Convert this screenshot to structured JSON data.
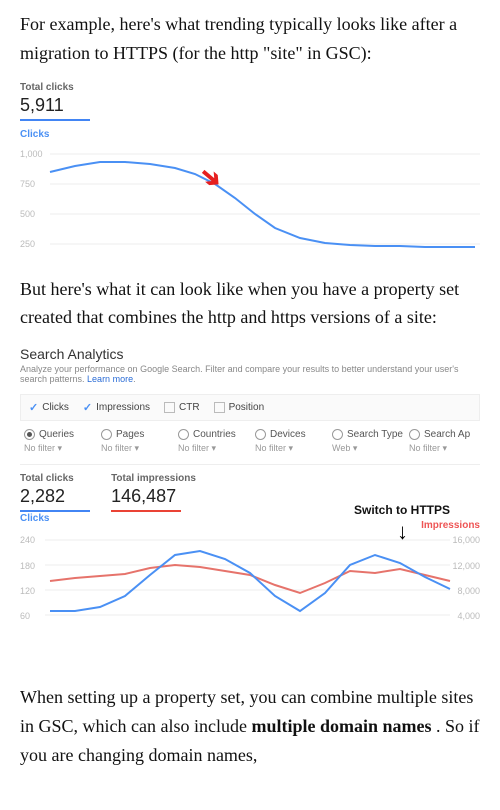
{
  "para1_a": "For example, here's what trending typically looks like after a migration to HTTPS (for the http \"site\" in GSC):",
  "para2": "But here's what it can look like when you have a property set created that combines the http and https versions of a site:",
  "para3_a": "When setting up a property set, you can combine multiple sites in GSC, which can also include ",
  "para3_b": "multiple domain names",
  "para3_c": ". So if you are changing domain names, ",
  "chart1": {
    "metric_label": "Total clicks",
    "metric_value": "5,911",
    "axis_label": "Clicks",
    "yticks": [
      "1,000",
      "750",
      "500",
      "250"
    ]
  },
  "sa_title": "Search Analytics",
  "sa_desc_a": "Analyze your performance on Google Search. Filter and compare your results to better understand your user's search patterns. ",
  "sa_desc_link": "Learn more",
  "sa_desc_b": ".",
  "toolbar": {
    "clicks": "Clicks",
    "impressions": "Impressions",
    "ctr": "CTR",
    "position": "Position"
  },
  "filters": [
    {
      "name": "Queries",
      "sub": "No filter ▾",
      "selected": true
    },
    {
      "name": "Pages",
      "sub": "No filter ▾",
      "selected": false
    },
    {
      "name": "Countries",
      "sub": "No filter ▾",
      "selected": false
    },
    {
      "name": "Devices",
      "sub": "No filter ▾",
      "selected": false
    },
    {
      "name": "Search Type",
      "sub": "Web ▾",
      "selected": false
    },
    {
      "name": "Search Ap",
      "sub": "No filter ▾",
      "selected": false
    }
  ],
  "chart2": {
    "m1_label": "Total clicks",
    "m1_value": "2,282",
    "m2_label": "Total impressions",
    "m2_value": "146,487",
    "axis_left_label": "Clicks",
    "axis_right_label": "Impressions",
    "annotation": "Switch to HTTPS",
    "yticks_left": [
      "240",
      "180",
      "120",
      "60"
    ],
    "yticks_right": [
      "16,000",
      "12,000",
      "8,000",
      "4,000"
    ]
  },
  "chart_data": [
    {
      "type": "line",
      "title": "Total clicks (http site after HTTPS migration)",
      "ylabel": "Clicks",
      "ylim": [
        0,
        1000
      ],
      "yticks": [
        250,
        500,
        750,
        1000
      ],
      "x": [
        0,
        1,
        2,
        3,
        4,
        5,
        6,
        7,
        8,
        9,
        10,
        11,
        12,
        13,
        14,
        15,
        16,
        17,
        18,
        19
      ],
      "values": [
        780,
        830,
        870,
        870,
        850,
        820,
        770,
        700,
        600,
        450,
        300,
        200,
        140,
        110,
        100,
        95,
        95,
        90,
        90,
        90
      ]
    },
    {
      "type": "line",
      "title": "Search Analytics — property set combining http + https",
      "xlabel": "",
      "series": [
        {
          "name": "Clicks",
          "ylim": [
            60,
            240
          ],
          "yticks": [
            60,
            120,
            180,
            240
          ],
          "values": [
            90,
            90,
            100,
            125,
            170,
            215,
            225,
            205,
            175,
            120,
            90,
            130,
            190,
            215,
            195,
            165,
            140
          ]
        },
        {
          "name": "Impressions",
          "ylim": [
            4000,
            16000
          ],
          "yticks": [
            4000,
            8000,
            12000,
            16000
          ],
          "values": [
            9500,
            10000,
            10500,
            11200,
            12500,
            13200,
            12800,
            12000,
            11300,
            9000,
            7800,
            9600,
            12000,
            11800,
            12600,
            11500,
            10000
          ]
        }
      ],
      "annotation": {
        "text": "Switch to HTTPS",
        "x_index": 12
      }
    }
  ]
}
